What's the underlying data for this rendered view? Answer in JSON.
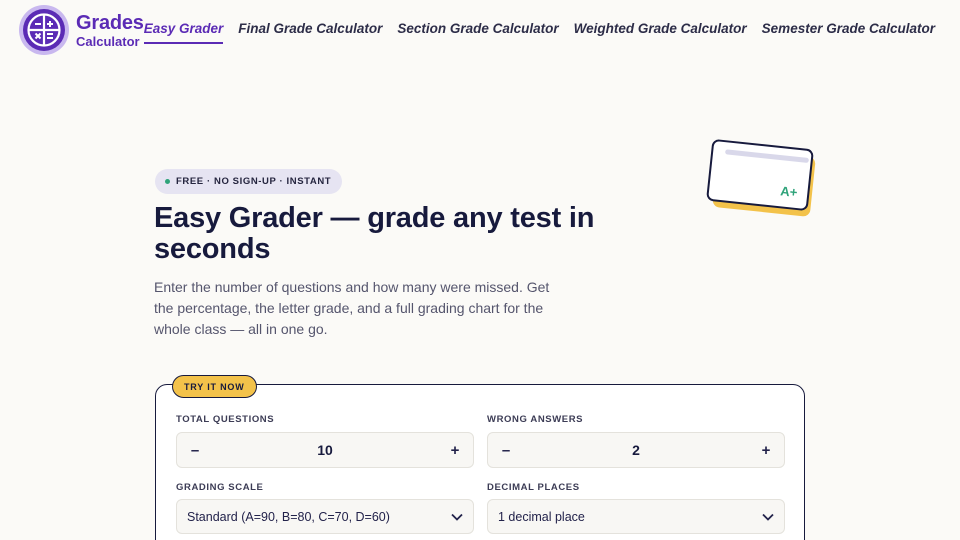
{
  "logo": {
    "line1": "Grades",
    "line2": "Calculator"
  },
  "nav": [
    {
      "label": "Easy Grader",
      "active": true
    },
    {
      "label": "Final Grade Calculator"
    },
    {
      "label": "Section Grade Calculator"
    },
    {
      "label": "Weighted Grade Calculator"
    },
    {
      "label": "Semester Grade Calculator"
    }
  ],
  "hero": {
    "badge": "FREE · NO SIGN-UP · INSTANT",
    "title": "Easy Grader — grade any test in seconds",
    "lead": "Enter the number of questions and how many were missed. Get the percentage, the letter grade, and a full grading chart for the whole class — all in one go.",
    "illustration_grade": "A+"
  },
  "calculator": {
    "tag": "TRY IT NOW",
    "total_questions": {
      "label": "TOTAL QUESTIONS",
      "value": "10",
      "minus": "–",
      "plus": "+"
    },
    "wrong_answers": {
      "label": "WRONG ANSWERS",
      "value": "2",
      "minus": "–",
      "plus": "+"
    },
    "grading_scale": {
      "label": "GRADING SCALE",
      "value": "Standard (A=90, B=80, C=70, D=60)"
    },
    "decimal_places": {
      "label": "DECIMAL PLACES",
      "value": "1 decimal place"
    }
  },
  "icons": {
    "logo": "math-operators-icon",
    "chevron": "chevron-down-icon"
  },
  "colors": {
    "brand": "#5b2bb5",
    "accent": "#f3c24a",
    "success": "#2fa37a",
    "ink": "#171a3d"
  }
}
